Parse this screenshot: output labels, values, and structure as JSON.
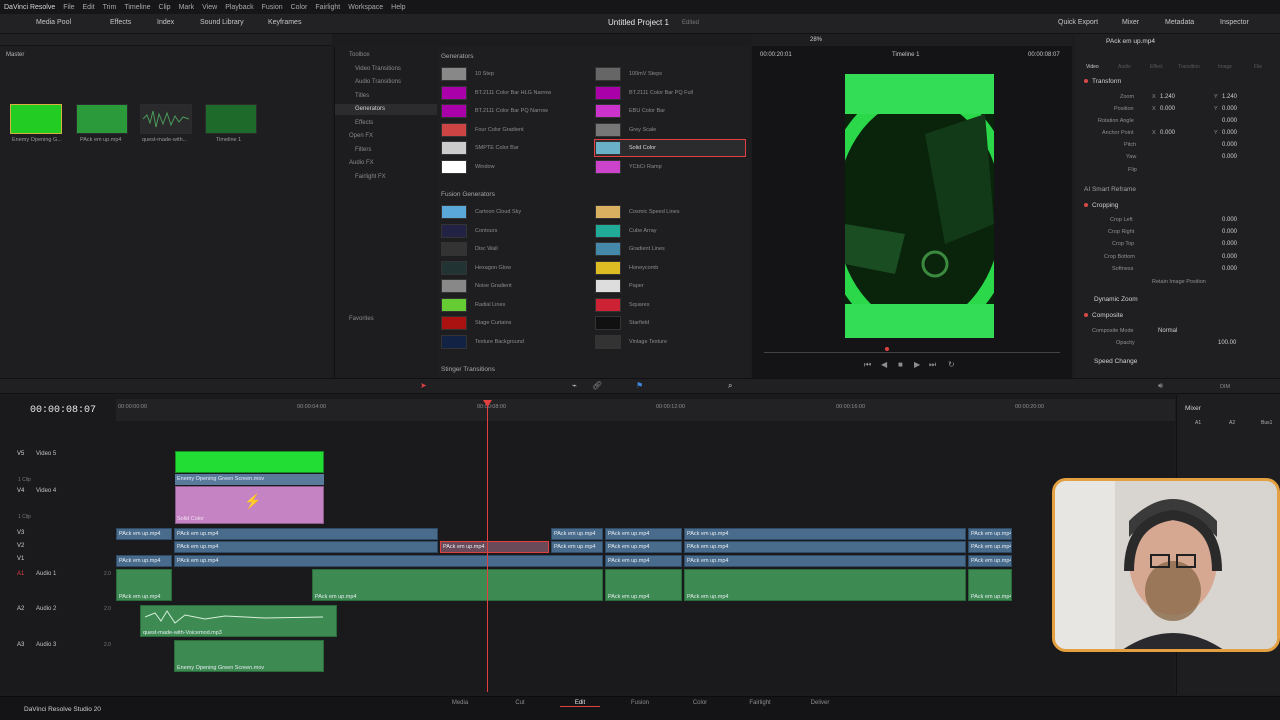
{
  "menu": {
    "app_name": "DaVinci Resolve",
    "items": [
      "File",
      "Edit",
      "Trim",
      "Timeline",
      "Clip",
      "Mark",
      "View",
      "Playback",
      "Fusion",
      "Color",
      "Fairlight",
      "Workspace",
      "Help"
    ]
  },
  "toolbar": {
    "left_tabs": [
      "Media Pool",
      "Effects",
      "Index",
      "Sound Library",
      "Keyframes"
    ],
    "project_title": "Untitled Project 1",
    "edited": "Edited",
    "right_tabs": [
      "Quick Export",
      "Mixer",
      "Metadata",
      "Inspector"
    ]
  },
  "media_pool": {
    "bin": "Master",
    "clips": [
      {
        "label": "Enemy Opening G...",
        "color": "#22cc22"
      },
      {
        "label": "PAck em up.mp4",
        "color": "#2a9a3a"
      },
      {
        "label": "quest-made-with...",
        "color": "#33553a"
      },
      {
        "label": "Timeline 1",
        "color": "#1e6a2a"
      }
    ]
  },
  "effects_tree": {
    "items": [
      "Toolbox",
      "Video Transitions",
      "Audio Transitions",
      "Titles",
      "Generators",
      "Effects",
      "Open FX",
      "Filters",
      "Audio FX",
      "Fairlight FX"
    ],
    "selected": "Generators",
    "favorites": "Favorites"
  },
  "generators": {
    "title": "Generators",
    "items": [
      {
        "label": "10 Step",
        "thumb": "#888"
      },
      {
        "label": "100mV Steps",
        "thumb": "#666"
      },
      {
        "label": "BT.2111 Color Bar HLG Narrow",
        "thumb": "#a0a"
      },
      {
        "label": "BT.2111 Color Bar PQ Full",
        "thumb": "#a0a"
      },
      {
        "label": "BT.2111 Color Bar PQ Narrow",
        "thumb": "#a0a"
      },
      {
        "label": "EBU Color Bar",
        "thumb": "#c3c"
      },
      {
        "label": "Four Color Gradient",
        "thumb": "#c44"
      },
      {
        "label": "Grey Scale",
        "thumb": "#777"
      },
      {
        "label": "SMPTE Color Bar",
        "thumb": "#ccc"
      },
      {
        "label": "Solid Color",
        "thumb": "#6ab0c8"
      },
      {
        "label": "Window",
        "thumb": "#fff"
      },
      {
        "label": "YCbCr Ramp",
        "thumb": "#c4c"
      }
    ],
    "selected": "Solid Color"
  },
  "fusion_generators": {
    "title": "Fusion Generators",
    "items": [
      {
        "label": "Cartoon Cloud Sky",
        "thumb": "#5aa8d8"
      },
      {
        "label": "Cosmic Speed Lines",
        "thumb": "#d8b060"
      },
      {
        "label": "Contours",
        "thumb": "#224"
      },
      {
        "label": "Cube Array",
        "thumb": "#2a9"
      },
      {
        "label": "Disc Wall",
        "thumb": "#333"
      },
      {
        "label": "Gradient Lines",
        "thumb": "#48a"
      },
      {
        "label": "Hexagon Glow",
        "thumb": "#233"
      },
      {
        "label": "Honeycomb",
        "thumb": "#db2"
      },
      {
        "label": "Noise Gradient",
        "thumb": "#888"
      },
      {
        "label": "Paper",
        "thumb": "#ddd"
      },
      {
        "label": "Radial Lines",
        "thumb": "#6c3"
      },
      {
        "label": "Squares",
        "thumb": "#c23"
      },
      {
        "label": "Stage Curtains",
        "thumb": "#a11"
      },
      {
        "label": "Starfield",
        "thumb": "#111"
      },
      {
        "label": "Texture Background",
        "thumb": "#124"
      },
      {
        "label": "Vintage Texture",
        "thumb": "#333"
      }
    ],
    "stinger": "Stinger Transitions"
  },
  "viewer": {
    "zoom": "28%",
    "timeline_name": "Timeline 1",
    "source_tc": "00:00:20:01",
    "current_tc": "00:00:08:07"
  },
  "inspector": {
    "clip_name": "PAck em up.mp4",
    "tabs": [
      "Video",
      "Audio",
      "Effect",
      "Transition",
      "Image",
      "File"
    ],
    "transform": {
      "title": "Transform",
      "zoom_label": "Zoom",
      "zoom_x": "1.240",
      "zoom_y": "1.240",
      "position_label": "Position",
      "position_x": "0.000",
      "position_y": "0.000",
      "rotation_label": "Rotation Angle",
      "rotation": "0.000",
      "anchor_label": "Anchor Point",
      "anchor_x": "0.000",
      "anchor_y": "0.000",
      "pitch_label": "Pitch",
      "pitch": "0.000",
      "yaw_label": "Yaw",
      "yaw": "0.000",
      "flip_label": "Flip"
    },
    "smart_reframe": "AI Smart Reframe",
    "cropping": {
      "title": "Cropping",
      "left_label": "Crop Left",
      "left": "0.000",
      "right_label": "Crop Right",
      "right": "0.000",
      "top_label": "Crop Top",
      "top": "0.000",
      "bottom_label": "Crop Bottom",
      "bottom": "0.000",
      "softness_label": "Softness",
      "softness": "0.000",
      "retain": "Retain Image Position"
    },
    "dynamic_zoom": "Dynamic Zoom",
    "composite": {
      "title": "Composite",
      "mode_label": "Composite Mode",
      "mode": "Normal",
      "opacity_label": "Opacity",
      "opacity": "100.00"
    },
    "speed_change": "Speed Change"
  },
  "timeline": {
    "timecode": "00:00:08:07",
    "ruler": [
      "00:00:00:00",
      "00:00:04:00",
      "00:00:08:00",
      "00:00:12:00",
      "00:00:16:00",
      "00:00:20:00"
    ],
    "tracks": [
      {
        "id": "V5",
        "name": "Video 5",
        "clips": "1 Clip"
      },
      {
        "id": "V4",
        "name": "Video 4",
        "clips": "1 Clip"
      },
      {
        "id": "V3",
        "name": ""
      },
      {
        "id": "V2",
        "name": ""
      },
      {
        "id": "V1",
        "name": ""
      },
      {
        "id": "A1",
        "name": "Audio 1",
        "level": "2.0"
      },
      {
        "id": "A2",
        "name": "Audio 2",
        "level": "2.0"
      },
      {
        "id": "A3",
        "name": "Audio 3",
        "level": "2.0"
      }
    ],
    "clip_labels": {
      "green_screen": "Enemy Opening Green Screen.mov",
      "solid": "Solid Color",
      "pack": "PAck em up.mp4",
      "quest": "quest-made-with-Voicemod.mp3",
      "green_audio": "Enemy Opening Green Screen.mov"
    }
  },
  "mixer": {
    "title": "Mixer",
    "channels": [
      "A1",
      "A2",
      "Bus1"
    ]
  },
  "pages": [
    "Media",
    "Cut",
    "Edit",
    "Fusion",
    "Color",
    "Fairlight",
    "Deliver"
  ],
  "active_page": "Edit",
  "studio_label": "DaVinci Resolve Studio 20",
  "dim_label": "DIM"
}
